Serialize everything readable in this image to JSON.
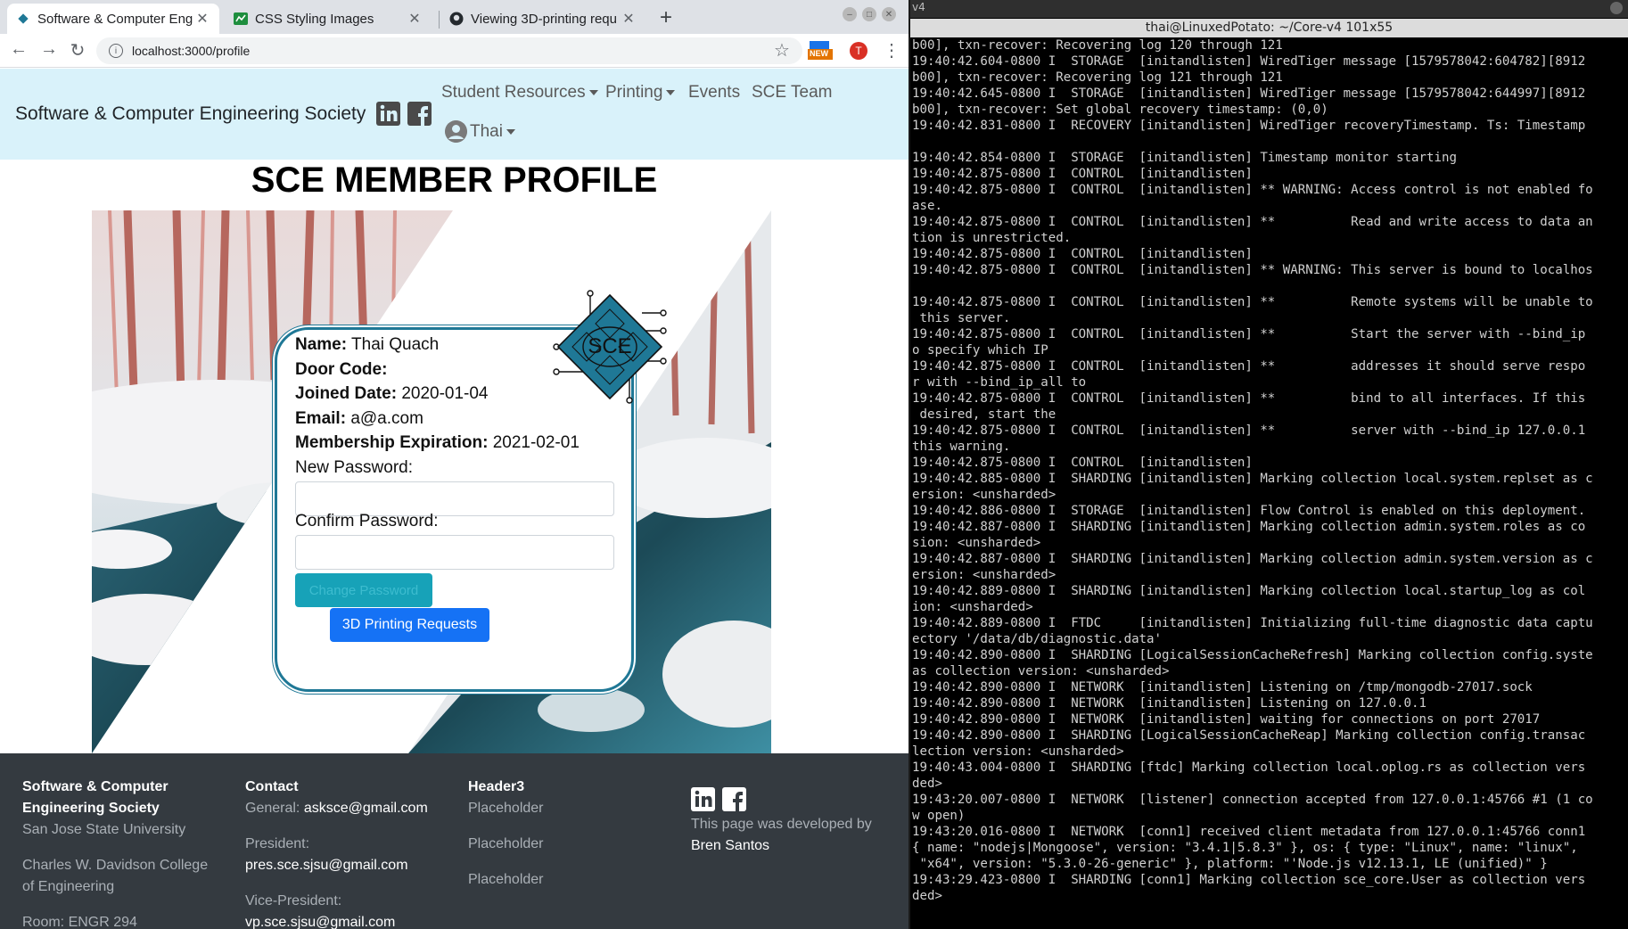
{
  "browser": {
    "tabs": [
      {
        "title": "Software & Computer Eng",
        "favicon": "sce-icon",
        "active": true
      },
      {
        "title": "CSS Styling Images",
        "favicon": "spreadsheet-icon",
        "active": false
      },
      {
        "title": "Viewing 3D-printing requ",
        "favicon": "github-icon",
        "active": false
      }
    ],
    "url": "localhost:3000/profile",
    "profile_initial": "T",
    "ext_badge": "NEW"
  },
  "navbar": {
    "brand": "Software & Computer Engineering Society",
    "links": [
      "Student Resources",
      "Printing",
      "Events",
      "SCE Team"
    ],
    "user": "Thai"
  },
  "profile": {
    "title": "SCE MEMBER PROFILE",
    "name_label": "Name:",
    "name": "Thai Quach",
    "door_label": "Door Code:",
    "door": "",
    "joined_label": "Joined Date:",
    "joined": "2020-01-04",
    "email_label": "Email:",
    "email": "a@a.com",
    "expiration_label": "Membership Expiration:",
    "expiration": "2021-02-01",
    "new_password_label": "New Password:",
    "confirm_password_label": "Confirm Password:",
    "change_password_button": "Change Password",
    "printing_button": "3D Printing Requests",
    "logo_text": "SCE"
  },
  "footer": {
    "col1_title_1": "Software & Computer",
    "col1_title_2": "Engineering Society",
    "col1_line1": "San Jose State University",
    "col1_line2": "Charles W. Davidson College",
    "col1_line3": "of Engineering",
    "col1_line4": "Room: ENGR 294",
    "col2_title": "Contact",
    "col2_general_label": "General:",
    "col2_general": "asksce@gmail.com",
    "col2_president_label": "President:",
    "col2_president": "pres.sce.sjsu@gmail.com",
    "col2_vp_label": "Vice-President:",
    "col2_vp": "vp.sce.sjsu@gmail.com",
    "col3_title": "Header3",
    "col3_items": [
      "Placeholder",
      "Placeholder",
      "Placeholder"
    ],
    "dev_text": "This page was developed by",
    "dev_name": "Bren Santos"
  },
  "terminal": {
    "top_label": "v4",
    "title": "thai@LinuxedPotato: ~/Core-v4 101x55",
    "lines": [
      "b00], txn-recover: Recovering log 120 through 121",
      "19:40:42.604-0800 I  STORAGE  [initandlisten] WiredTiger message [1579578042:604782][8912",
      "b00], txn-recover: Recovering log 121 through 121",
      "19:40:42.645-0800 I  STORAGE  [initandlisten] WiredTiger message [1579578042:644997][8912",
      "b00], txn-recover: Set global recovery timestamp: (0,0)",
      "19:40:42.831-0800 I  RECOVERY [initandlisten] WiredTiger recoveryTimestamp. Ts: Timestamp",
      "",
      "19:40:42.854-0800 I  STORAGE  [initandlisten] Timestamp monitor starting",
      "19:40:42.875-0800 I  CONTROL  [initandlisten]",
      "19:40:42.875-0800 I  CONTROL  [initandlisten] ** WARNING: Access control is not enabled fo",
      "ase.",
      "19:40:42.875-0800 I  CONTROL  [initandlisten] **          Read and write access to data an",
      "tion is unrestricted.",
      "19:40:42.875-0800 I  CONTROL  [initandlisten]",
      "19:40:42.875-0800 I  CONTROL  [initandlisten] ** WARNING: This server is bound to localhos",
      "",
      "19:40:42.875-0800 I  CONTROL  [initandlisten] **          Remote systems will be unable to",
      " this server.",
      "19:40:42.875-0800 I  CONTROL  [initandlisten] **          Start the server with --bind_ip",
      "o specify which IP",
      "19:40:42.875-0800 I  CONTROL  [initandlisten] **          addresses it should serve respo",
      "r with --bind_ip_all to",
      "19:40:42.875-0800 I  CONTROL  [initandlisten] **          bind to all interfaces. If this",
      " desired, start the",
      "19:40:42.875-0800 I  CONTROL  [initandlisten] **          server with --bind_ip 127.0.0.1",
      "this warning.",
      "19:40:42.875-0800 I  CONTROL  [initandlisten]",
      "19:40:42.885-0800 I  SHARDING [initandlisten] Marking collection local.system.replset as c",
      "ersion: <unsharded>",
      "19:40:42.886-0800 I  STORAGE  [initandlisten] Flow Control is enabled on this deployment.",
      "19:40:42.887-0800 I  SHARDING [initandlisten] Marking collection admin.system.roles as co",
      "sion: <unsharded>",
      "19:40:42.887-0800 I  SHARDING [initandlisten] Marking collection admin.system.version as c",
      "ersion: <unsharded>",
      "19:40:42.889-0800 I  SHARDING [initandlisten] Marking collection local.startup_log as col",
      "ion: <unsharded>",
      "19:40:42.889-0800 I  FTDC     [initandlisten] Initializing full-time diagnostic data captu",
      "ectory '/data/db/diagnostic.data'",
      "19:40:42.890-0800 I  SHARDING [LogicalSessionCacheRefresh] Marking collection config.syste",
      "as collection version: <unsharded>",
      "19:40:42.890-0800 I  NETWORK  [initandlisten] Listening on /tmp/mongodb-27017.sock",
      "19:40:42.890-0800 I  NETWORK  [initandlisten] Listening on 127.0.0.1",
      "19:40:42.890-0800 I  NETWORK  [initandlisten] waiting for connections on port 27017",
      "19:40:42.890-0800 I  SHARDING [LogicalSessionCacheReap] Marking collection config.transac",
      "lection version: <unsharded>",
      "19:40:43.004-0800 I  SHARDING [ftdc] Marking collection local.oplog.rs as collection vers",
      "ded>",
      "19:43:20.007-0800 I  NETWORK  [listener] connection accepted from 127.0.0.1:45766 #1 (1 co",
      "w open)",
      "19:43:20.016-0800 I  NETWORK  [conn1] received client metadata from 127.0.0.1:45766 conn1",
      "{ name: \"nodejs|Mongoose\", version: \"3.4.1|5.8.3\" }, os: { type: \"Linux\", name: \"linux\", ",
      " \"x64\", version: \"5.3.0-26-generic\" }, platform: \"'Node.js v12.13.1, LE (unified)\" }",
      "19:43:29.423-0800 I  SHARDING [conn1] Marking collection sce_core.User as collection vers",
      "ded>"
    ]
  }
}
